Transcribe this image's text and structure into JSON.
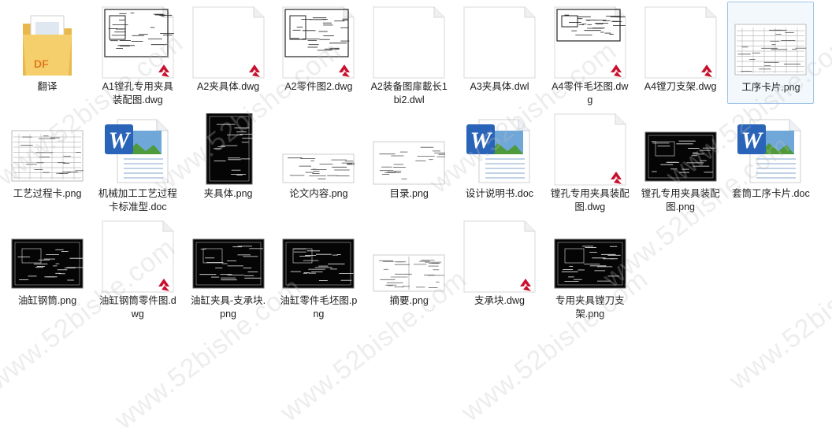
{
  "watermark": "www.52bishe.com",
  "files": [
    {
      "name": "翻译",
      "type": "folder"
    },
    {
      "name": "A1镗孔专用夹具装配图.dwg",
      "type": "dwg-drawing"
    },
    {
      "name": "A2夹具体.dwg",
      "type": "dwg-blank"
    },
    {
      "name": "A2零件图2.dwg",
      "type": "dwg-drawing"
    },
    {
      "name": "A2装备图扉載长1bi2.dwl",
      "type": "generic"
    },
    {
      "name": "A3夹具体.dwl",
      "type": "generic"
    },
    {
      "name": "A4零件毛坯图.dwg",
      "type": "dwg-drawing"
    },
    {
      "name": "A4镗刀支架.dwg",
      "type": "dwg-blank"
    },
    {
      "name": "工序卡片.png",
      "type": "png-table",
      "selected": true
    },
    {
      "name": "工艺过程卡.png",
      "type": "png-table"
    },
    {
      "name": "机械加工工艺过程卡标准型.doc",
      "type": "word"
    },
    {
      "name": "夹具体.png",
      "type": "png-black-tall"
    },
    {
      "name": "论文内容.png",
      "type": "png-text"
    },
    {
      "name": "目录.png",
      "type": "png-toc"
    },
    {
      "name": "设计说明书.doc",
      "type": "word"
    },
    {
      "name": "镗孔专用夹具装配图.dwg",
      "type": "dwg-blank"
    },
    {
      "name": "镗孔专用夹具装配图.png",
      "type": "png-black"
    },
    {
      "name": "套筒工序卡片.doc",
      "type": "word"
    },
    {
      "name": "油缸钢筒.png",
      "type": "png-black"
    },
    {
      "name": "油缸钢筒零件图.dwg",
      "type": "dwg-blank"
    },
    {
      "name": "油缸夹具-支承块.png",
      "type": "png-black"
    },
    {
      "name": "油缸零件毛坯图.png",
      "type": "png-black"
    },
    {
      "name": "摘要.png",
      "type": "png-book"
    },
    {
      "name": "支承块.dwg",
      "type": "dwg-blank"
    },
    {
      "name": "专用夹具镗刀支架.png",
      "type": "png-black"
    }
  ]
}
